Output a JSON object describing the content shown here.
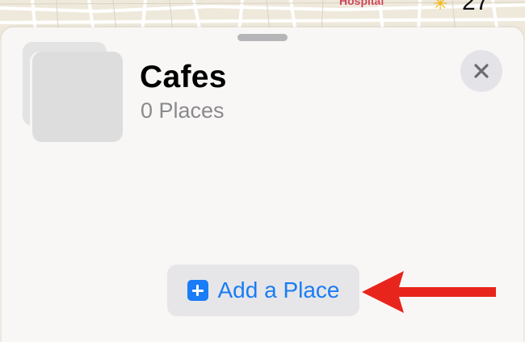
{
  "map": {
    "poi_label": "Hospital",
    "weather_icon": "sun-icon",
    "temperature": "27"
  },
  "sheet": {
    "grabber_icon": "grabber-handle",
    "collection_title": "Cafes",
    "collection_subtitle": "0 Places",
    "close_icon": "close-icon",
    "add_button": {
      "label": "Add a Place",
      "icon": "plus-square-icon"
    }
  },
  "annotation": {
    "arrow_icon": "left-arrow-icon",
    "arrow_color": "#e8251c"
  },
  "colors": {
    "accent": "#1a7cf6",
    "title": "#000000",
    "subtitle": "#8a8a8e"
  }
}
